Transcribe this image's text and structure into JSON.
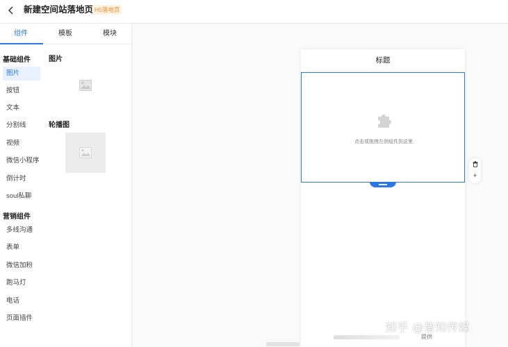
{
  "header": {
    "title": "新建空间站落地页",
    "badge": "H5落地页",
    "back_icon": "chevron-left-icon"
  },
  "left_panel": {
    "tabs": [
      {
        "label": "组件",
        "active": true
      },
      {
        "label": "模板",
        "active": false
      },
      {
        "label": "模块",
        "active": false
      }
    ],
    "basic_header": "基础组件",
    "basic_items": [
      {
        "label": "图片",
        "active": true
      },
      {
        "label": "按钮",
        "active": false
      },
      {
        "label": "文本",
        "active": false
      },
      {
        "label": "分割线",
        "active": false
      },
      {
        "label": "视频",
        "active": false
      },
      {
        "label": "微信小程序",
        "active": false
      },
      {
        "label": "倒计时",
        "active": false
      },
      {
        "label": "soul私聊",
        "active": false
      }
    ],
    "marketing_header": "营销组件",
    "marketing_items": [
      {
        "label": "多线沟通"
      },
      {
        "label": "表单"
      },
      {
        "label": "微信加粉"
      },
      {
        "label": "跑马灯"
      },
      {
        "label": "电话"
      },
      {
        "label": "页面插件"
      }
    ],
    "widgets": [
      {
        "title": "图片",
        "icon": "image-placeholder-icon"
      },
      {
        "title": "轮播图",
        "icon": "image-placeholder-icon"
      }
    ]
  },
  "canvas": {
    "phone_title": "标题",
    "drop_hint": "点击或拖拽左侧组件到这里",
    "drop_icon": "puzzle-icon",
    "tools": {
      "delete_icon": "trash-icon",
      "add_label": "+"
    },
    "footer_right": "提供"
  },
  "watermark": "知乎 @皆知传媒",
  "colors": {
    "accent": "#2b78e4",
    "badge_text": "#f08a24",
    "badge_bg": "#fff3e6",
    "active_item_bg": "#e8f1ff"
  }
}
